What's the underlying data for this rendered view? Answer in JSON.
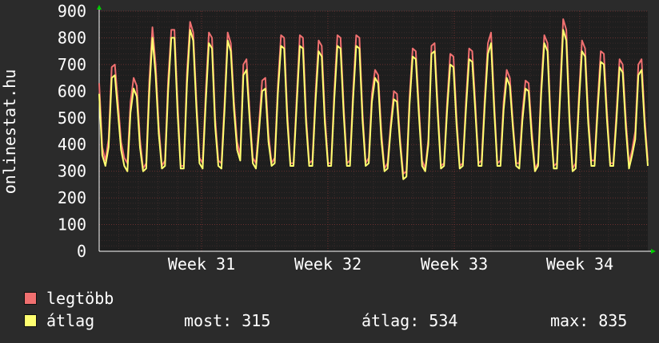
{
  "chart_data": {
    "type": "line",
    "vertical_label": "onlinestat.hu",
    "ylim": [
      0,
      900
    ],
    "y_ticks": [
      0,
      100,
      200,
      300,
      400,
      500,
      600,
      700,
      800,
      900
    ],
    "x_tick_labels": [
      "Week 31",
      "Week 32",
      "Week 33",
      "Week 34"
    ],
    "grid": true,
    "legend_placement": "bottom-left",
    "series": [
      {
        "name": "legtöbb",
        "color": "#f07070",
        "values": [
          630,
          390,
          340,
          420,
          690,
          700,
          560,
          410,
          350,
          330,
          560,
          650,
          620,
          420,
          310,
          330,
          640,
          840,
          700,
          470,
          320,
          340,
          640,
          830,
          830,
          560,
          320,
          320,
          670,
          860,
          820,
          570,
          350,
          330,
          600,
          820,
          800,
          500,
          340,
          330,
          560,
          820,
          780,
          560,
          410,
          360,
          700,
          720,
          520,
          350,
          330,
          480,
          640,
          650,
          440,
          330,
          350,
          620,
          810,
          800,
          520,
          330,
          330,
          580,
          810,
          800,
          510,
          330,
          340,
          590,
          790,
          770,
          510,
          330,
          330,
          600,
          810,
          800,
          540,
          330,
          340,
          600,
          810,
          800,
          520,
          330,
          350,
          590,
          680,
          660,
          450,
          310,
          330,
          480,
          600,
          590,
          420,
          290,
          300,
          580,
          760,
          750,
          540,
          340,
          310,
          420,
          770,
          780,
          540,
          320,
          330,
          560,
          740,
          730,
          500,
          320,
          330,
          560,
          760,
          750,
          550,
          330,
          340,
          580,
          780,
          820,
          560,
          330,
          340,
          560,
          680,
          650,
          480,
          330,
          330,
          520,
          640,
          630,
          450,
          310,
          330,
          620,
          810,
          780,
          500,
          320,
          330,
          600,
          870,
          830,
          520,
          310,
          330,
          580,
          790,
          760,
          510,
          340,
          340,
          560,
          750,
          740,
          520,
          330,
          330,
          520,
          720,
          700,
          490,
          330,
          380,
          450,
          700,
          720,
          500,
          340
        ]
      },
      {
        "name": "átlag",
        "color": "#ffff70",
        "values": [
          590,
          360,
          320,
          390,
          650,
          660,
          520,
          380,
          320,
          300,
          520,
          610,
          580,
          390,
          300,
          310,
          600,
          800,
          660,
          440,
          310,
          320,
          600,
          800,
          800,
          520,
          310,
          310,
          630,
          830,
          790,
          540,
          330,
          310,
          560,
          780,
          760,
          470,
          320,
          310,
          530,
          790,
          750,
          530,
          380,
          340,
          660,
          680,
          490,
          330,
          310,
          450,
          600,
          610,
          410,
          320,
          330,
          590,
          770,
          760,
          490,
          320,
          320,
          550,
          770,
          760,
          480,
          320,
          320,
          560,
          750,
          730,
          480,
          320,
          320,
          570,
          770,
          760,
          510,
          320,
          320,
          570,
          770,
          760,
          490,
          320,
          330,
          560,
          650,
          630,
          420,
          300,
          310,
          460,
          570,
          560,
          400,
          270,
          280,
          550,
          730,
          720,
          510,
          320,
          300,
          400,
          740,
          750,
          510,
          310,
          320,
          530,
          700,
          690,
          470,
          310,
          320,
          530,
          720,
          710,
          520,
          320,
          320,
          550,
          740,
          780,
          530,
          320,
          320,
          530,
          650,
          620,
          460,
          320,
          310,
          490,
          610,
          600,
          420,
          300,
          320,
          590,
          780,
          750,
          470,
          310,
          310,
          570,
          830,
          790,
          490,
          300,
          310,
          550,
          750,
          730,
          480,
          320,
          320,
          530,
          710,
          700,
          490,
          320,
          320,
          490,
          690,
          670,
          460,
          310,
          360,
          420,
          660,
          680,
          470,
          320
        ]
      }
    ]
  },
  "legend": {
    "items": [
      {
        "label": "legtöbb",
        "color": "#f07070"
      },
      {
        "label": "átlag",
        "color": "#ffff70"
      }
    ]
  },
  "stats": {
    "most": "most: 315",
    "atlag": "átlag: 534",
    "max": "max: 835"
  }
}
